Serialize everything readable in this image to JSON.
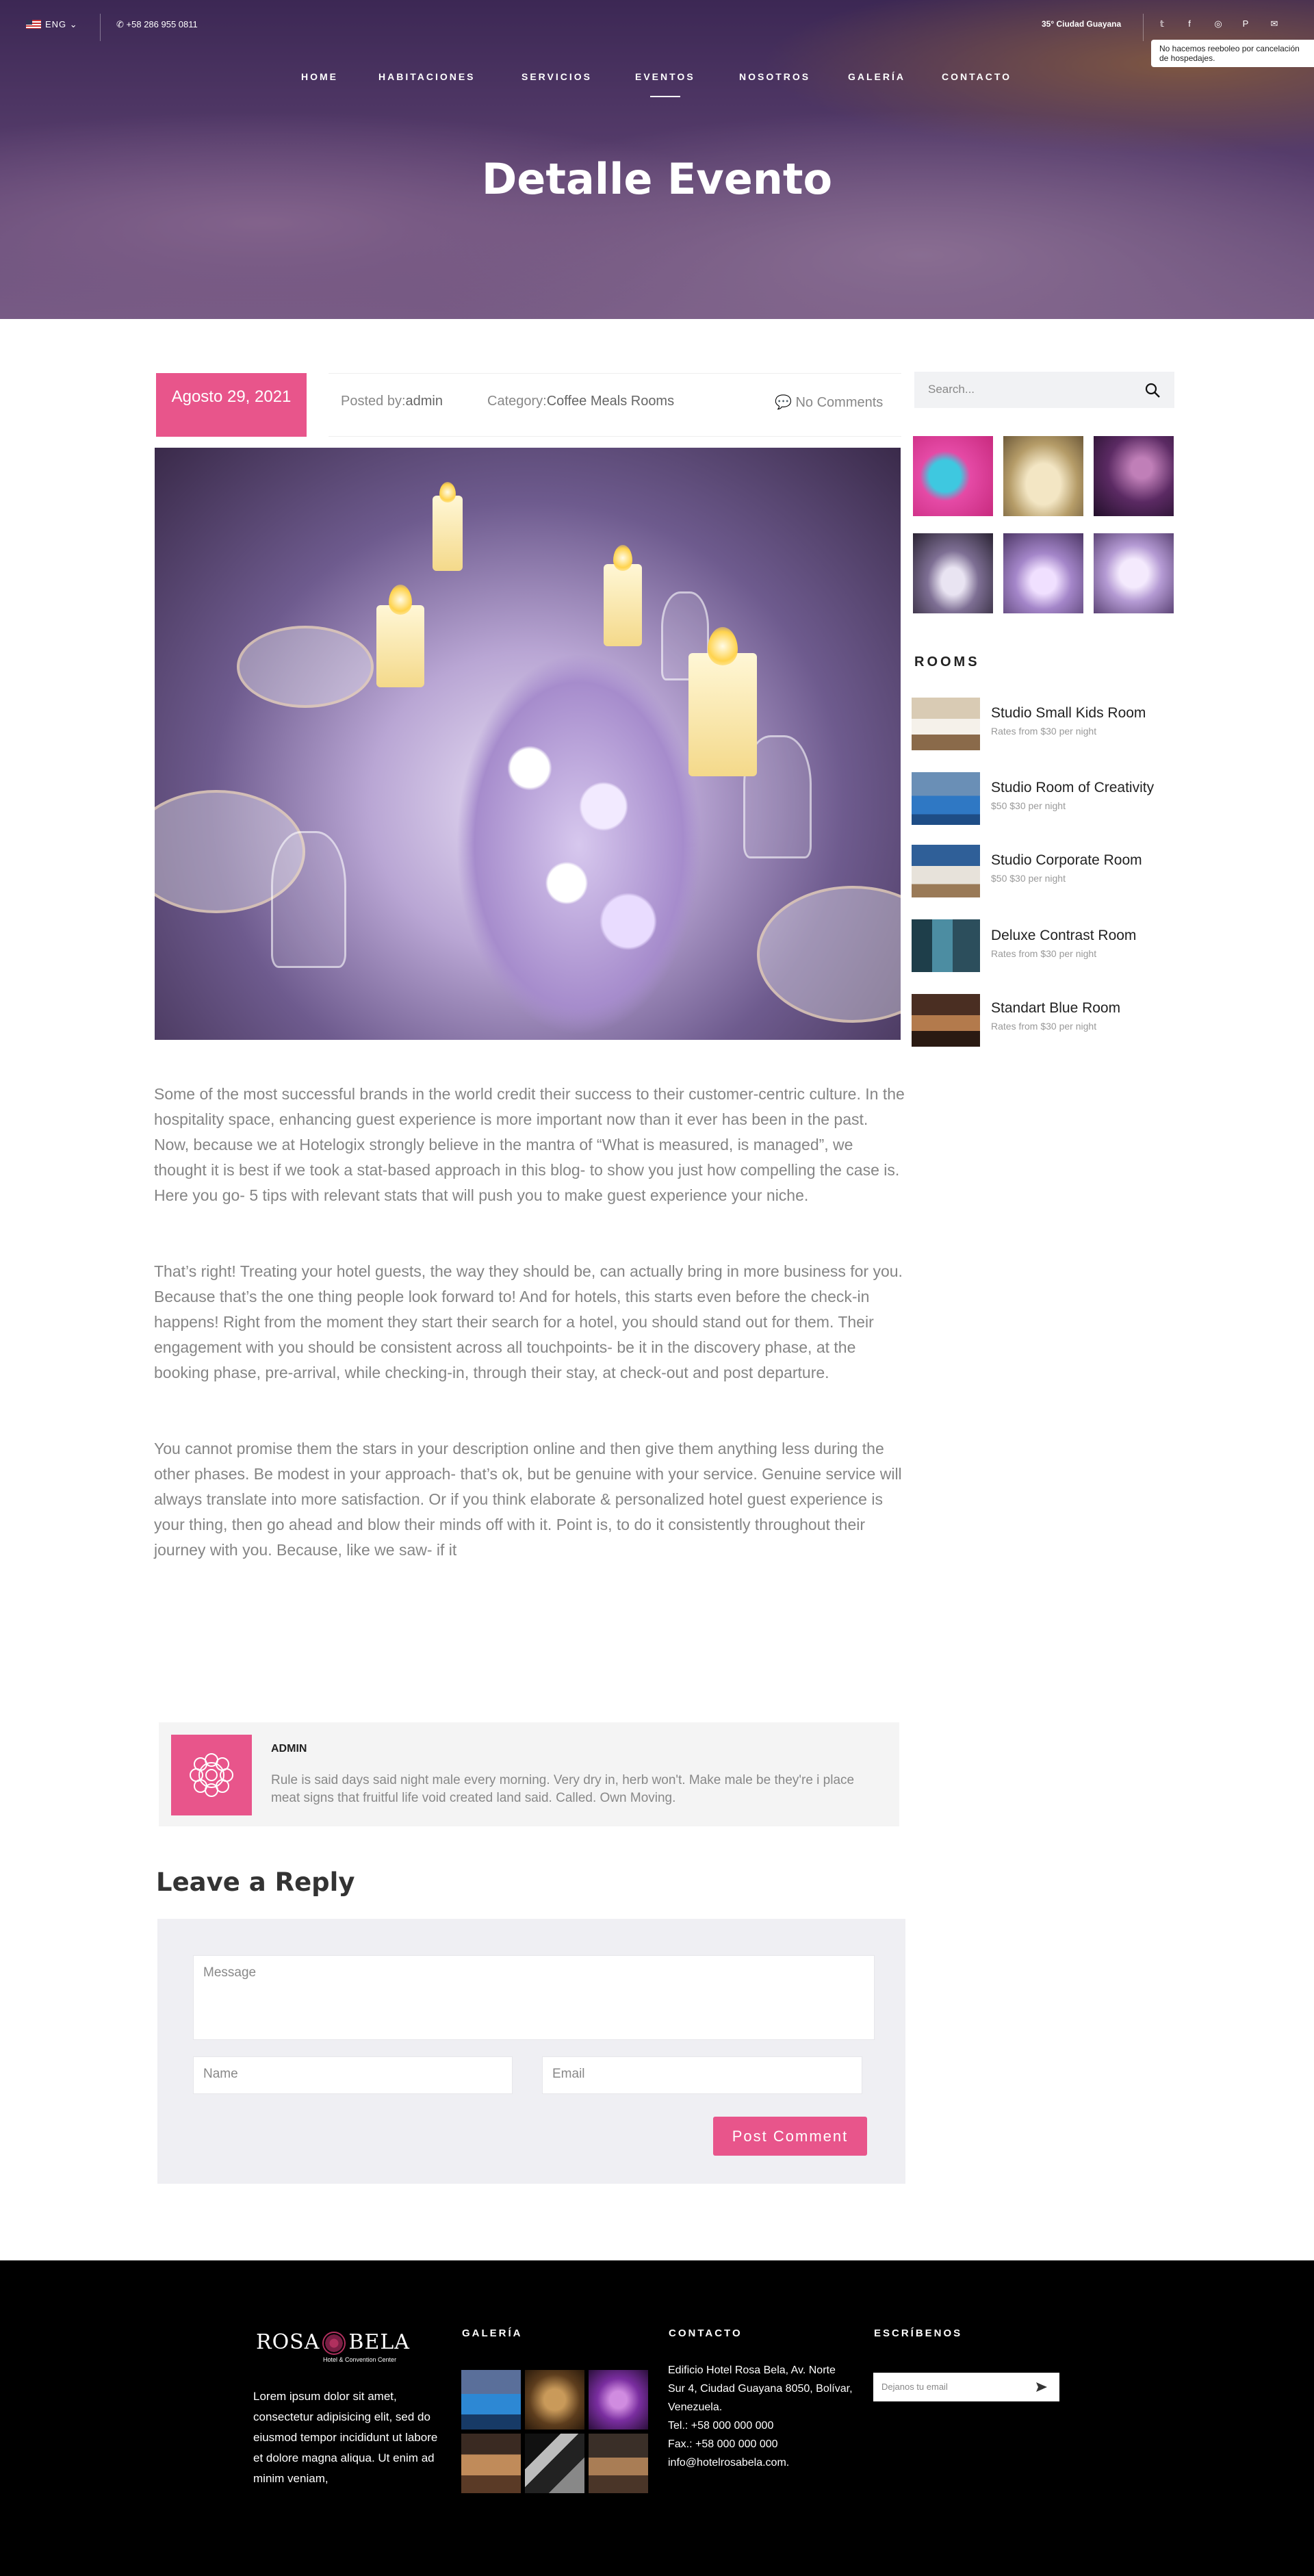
{
  "topbar": {
    "lang": "ENG",
    "phone": "+58 286 955 0811",
    "weather": "35° Ciudad Guayana",
    "notice": "No hacemos reeboleo por cancelación de hospedajes.",
    "social": [
      {
        "icon": "twitter-icon",
        "glyph": "𝕥"
      },
      {
        "icon": "facebook-icon",
        "glyph": "f"
      },
      {
        "icon": "instagram-icon",
        "glyph": "◎"
      },
      {
        "icon": "pinterest-icon",
        "glyph": "P"
      },
      {
        "icon": "mail-icon",
        "glyph": "✉"
      }
    ]
  },
  "nav": {
    "items": [
      "HOME",
      "HABITACIONES",
      "SERVICIOS",
      "EVENTOS",
      "NOSOTROS",
      "GALERÍA",
      "CONTACTO"
    ]
  },
  "hero": {
    "title": "Detalle Evento"
  },
  "post": {
    "date": "Agosto 29, 2021",
    "posted_label": "Posted by:",
    "author": "admin",
    "category_label": "Category:",
    "category": "Coffee Meals Rooms",
    "comments": "No Comments",
    "paragraphs": [
      "Some of the most successful brands in the world credit their success to their customer-centric culture. In the hospitality space, enhancing guest experience is more important now than it ever has been in the past. Now, because we at Hotelogix strongly believe in the mantra of “What is measured, is managed”, we thought it is best if we took a stat-based approach in this blog- to show you just how compelling the case is. Here you go- 5 tips with relevant stats that will push you to make guest experience your niche.",
      "That’s right! Treating your hotel guests, the way they should be, can actually bring in more business for you. Because that’s the one thing people look forward to! And for hotels, this starts even before the check-in happens! Right from the moment they start their search for a hotel, you should stand out for them. Their engagement with you should be consistent across all touchpoints- be it in the discovery phase, at the booking phase, pre-arrival, while checking-in, through their stay, at check-out and post departure.",
      "You cannot promise them the stars in your description online and then give them anything less during the other phases. Be modest in your approach- that’s ok, but be genuine with your service. Genuine service will always translate into more satisfaction. Or if you think elaborate & personalized hotel guest experience is your thing, then go ahead and blow their minds off with it. Point is, to do it consistently throughout their journey with you. Because, like we saw- if it"
    ]
  },
  "sidebar": {
    "search_placeholder": "Search...",
    "rooms_heading": "ROOMS",
    "rooms": [
      {
        "name": "Studio Small Kids Room",
        "price": "Rates from $30 per night"
      },
      {
        "name": "Studio Room of Creativity",
        "price": "$50 $30 per night"
      },
      {
        "name": "Studio Corporate Room",
        "price": "$50  $30 per night"
      },
      {
        "name": "Deluxe Contrast Room",
        "price": "Rates from $30 per night"
      },
      {
        "name": "Standart Blue Room",
        "price": "Rates from $30 per night"
      }
    ]
  },
  "author_box": {
    "name": "ADMIN",
    "bio": "Rule is said days said night male every morning. Very dry in, herb won't. Make male be they're i place meat signs that fruitful life void created land said. Called. Own Moving."
  },
  "reply": {
    "title": "Leave a Reply",
    "message_placeholder": "Message",
    "name_placeholder": "Name",
    "email_placeholder": "Email",
    "submit": "Post Comment"
  },
  "footer": {
    "logo_left": "ROSA",
    "logo_right": "BELA",
    "logo_sub": "Hotel & Convention Center",
    "about": "Lorem ipsum dolor sit amet, consectetur adipisicing elit, sed do eiusmod tempor incididunt ut labore et dolore magna aliqua. Ut enim ad minim veniam,",
    "galeria_head": "GALERÍA",
    "contacto_head": "CONTACTO",
    "escribenos_head": "ESCRÍBENOS",
    "address": "Edificio Hotel Rosa Bela, Av. Norte Sur 4, Ciudad Guayana 8050, Bolívar, Venezuela.",
    "tel": "Tel.: +58 000 000 000",
    "fax": "Fax.: +58 000 000 000",
    "email": "info@hotelrosabela.com.",
    "newsletter_placeholder": "Dejanos tu email"
  }
}
